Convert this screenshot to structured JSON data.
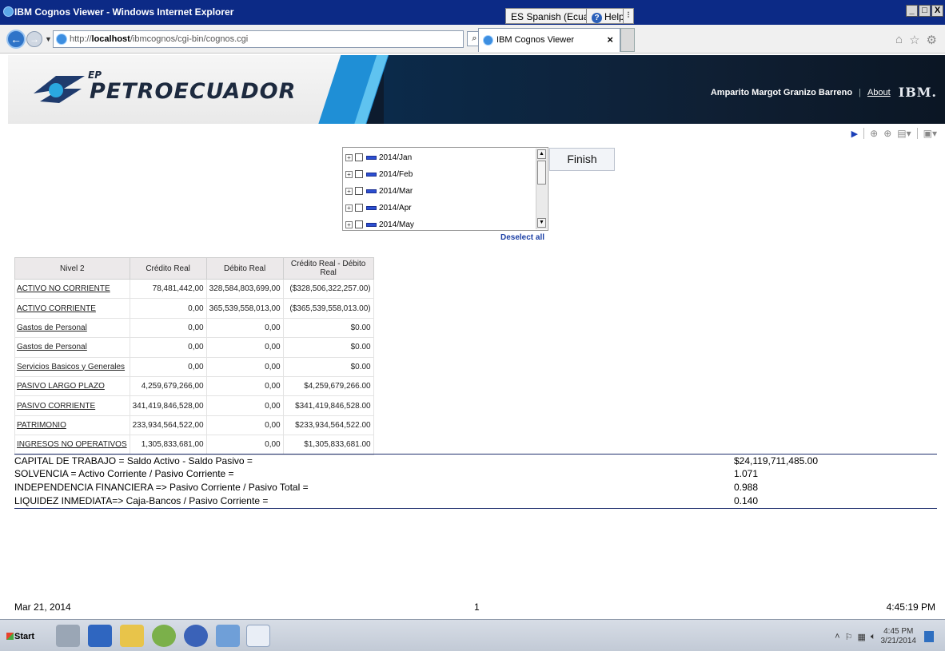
{
  "window": {
    "title": "IBM Cognos Viewer - Windows Internet Explorer",
    "language": "ES Spanish (Ecuador)",
    "help": "Help",
    "buttons": [
      "_",
      "□",
      "X"
    ]
  },
  "browser": {
    "url_prefix": "http://",
    "url_host": "localhost",
    "url_path": "/ibmcognos/cgi-bin/cognos.cgi",
    "tab_title": "IBM Cognos Viewer"
  },
  "header": {
    "brand_ep": "EP",
    "brand_name": "PETROECUADOR",
    "user_name": "Amparito Margot Granizo Barreno",
    "about": "About",
    "ibm": "IBM."
  },
  "prompt": {
    "items": [
      "2014/Jan",
      "2014/Feb",
      "2014/Mar",
      "2014/Apr",
      "2014/May"
    ],
    "finish": "Finish",
    "deselect": "Deselect all"
  },
  "table": {
    "headers": [
      "Nivel 2",
      "Crédito Real",
      "Débito Real",
      "Crédito Real - Débito Real"
    ],
    "rows": [
      [
        "ACTIVO NO CORRIENTE",
        "78,481,442,00",
        "328,584,803,699,00",
        "($328,506,322,257.00)"
      ],
      [
        "ACTIVO CORRIENTE",
        "0,00",
        "365,539,558,013,00",
        "($365,539,558,013.00)"
      ],
      [
        "Gastos de Personal",
        "0,00",
        "0,00",
        "$0.00"
      ],
      [
        "Gastos de Personal",
        "0,00",
        "0,00",
        "$0.00"
      ],
      [
        "Servicios  Basicos y Generales",
        "0,00",
        "0,00",
        "$0.00"
      ],
      [
        "PASIVO LARGO PLAZO",
        "4,259,679,266,00",
        "0,00",
        "$4,259,679,266.00"
      ],
      [
        "PASIVO CORRIENTE",
        "341,419,846,528,00",
        "0,00",
        "$341,419,846,528.00"
      ],
      [
        "PATRIMONIO",
        "233,934,564,522,00",
        "0,00",
        "$233,934,564,522.00"
      ],
      [
        "INGRESOS NO OPERATIVOS",
        "1,305,833,681,00",
        "0,00",
        "$1,305,833,681.00"
      ]
    ]
  },
  "ratios": [
    {
      "label": "CAPITAL DE TRABAJO = Saldo Activo - Saldo Pasivo =",
      "value": "$24,119,711,485.00"
    },
    {
      "label": "SOLVENCIA = Activo Corriente / Pasivo Corriente =",
      "value": "1.071"
    },
    {
      "label": "INDEPENDENCIA FINANCIERA => Pasivo Corriente / Pasivo Total =",
      "value": "0.988"
    },
    {
      "label": "LIQUIDEZ INMEDIATA=> Caja-Bancos / Pasivo Corriente =",
      "value": "0.140"
    }
  ],
  "footer": {
    "date": "Mar 21, 2014",
    "page": "1",
    "time": "4:45:19 PM"
  },
  "taskbar": {
    "start": "Start",
    "clock_time": "4:45 PM",
    "clock_date": "3/21/2014"
  },
  "colors": {
    "titlebar": "#0c2a86",
    "link": "#1b3fa5",
    "rule": "#20306e"
  }
}
